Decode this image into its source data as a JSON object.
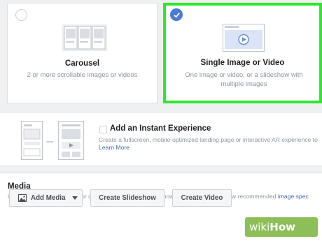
{
  "formats": {
    "carousel": {
      "title": "Carousel",
      "description": "2 or more scrollable images or videos",
      "selected": false
    },
    "single": {
      "title": "Single Image or Video",
      "description": "One image or video, or a slideshow with multiple images",
      "selected": true
    }
  },
  "instant_experience": {
    "title": "Add an Instant Experience",
    "description": "Create a fullscreen, mobile-optimized landing page or interactive AR experience to",
    "learn_more": "Learn More",
    "checked": false
  },
  "media": {
    "heading": "Media",
    "description": "Choose an image or video, or create a new video or slideshow using a template. View recommended ",
    "link": "image spec",
    "buttons": {
      "add_media": "Add Media",
      "create_slideshow": "Create Slideshow",
      "create_video": "Create Video"
    }
  },
  "watermark": {
    "wiki": "wiki",
    "how": "How"
  },
  "colors": {
    "selection_outline": "#2ee82e",
    "radio_checked": "#4b79d6",
    "link": "#4267b2",
    "watermark": "#8cbf57"
  }
}
